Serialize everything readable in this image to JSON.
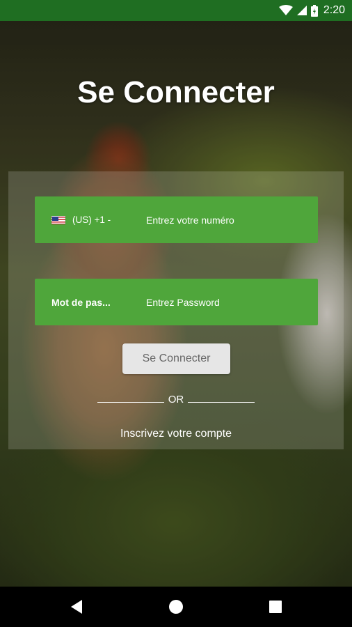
{
  "status_bar": {
    "time": "2:20",
    "icons": [
      "wifi-icon",
      "cell-signal-icon",
      "battery-icon"
    ]
  },
  "title": "Se Connecter",
  "phone_field": {
    "flag": "us-flag-icon",
    "country_code": "(US) +1 -",
    "placeholder": "Entrez votre numéro"
  },
  "password_field": {
    "label": "Mot de pas...",
    "placeholder": "Entrez Password"
  },
  "login_button": "Se Connecter",
  "or_text": "OR",
  "register_link": "Inscrivez votre compte",
  "nav_bar": {
    "icons": [
      "back-icon",
      "home-icon",
      "recents-icon"
    ]
  },
  "colors": {
    "status_bar": "#1f6e22",
    "field_green": "#4fa63b",
    "button_bg": "#e6e6e6"
  }
}
